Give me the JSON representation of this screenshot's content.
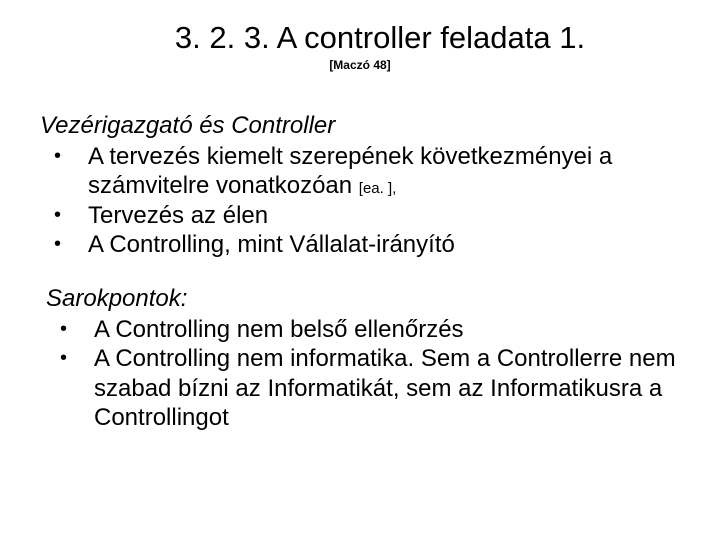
{
  "title": "3. 2. 3. A controller feladata 1.",
  "citation": "[Maczó 48]",
  "section1": {
    "heading": "Vezérigazgató és Controller",
    "items": [
      {
        "text_a": "A tervezés kiemelt szerepének következményei a számvitelre vonatkozóan ",
        "small": "[ea. ],",
        "text_b": ""
      },
      {
        "text_a": "Tervezés az élen",
        "small": "",
        "text_b": ""
      },
      {
        "text_a": "A Controlling, mint Vállalat-irányító",
        "small": "",
        "text_b": ""
      }
    ]
  },
  "section2": {
    "heading": "Sarokpontok:",
    "items": [
      {
        "text_a": "A Controlling nem belső ellenőrzés"
      },
      {
        "text_a": "A Controlling nem informatika. Sem a Controllerre nem szabad bízni az Informatikát, sem az Informatikusra a Controllingot"
      }
    ]
  }
}
